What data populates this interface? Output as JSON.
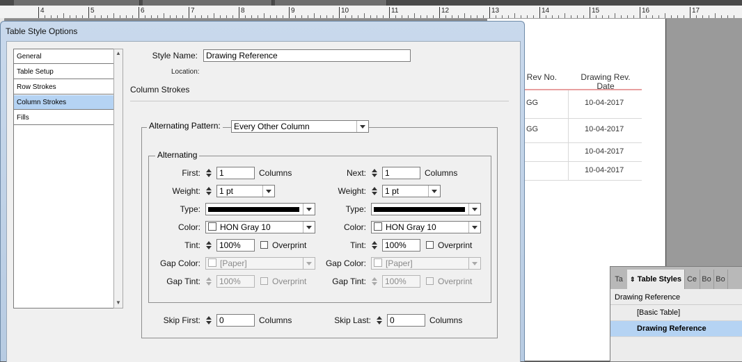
{
  "dialog": {
    "title": "Table Style Options",
    "categories": [
      "General",
      "Table Setup",
      "Row Strokes",
      "Column Strokes",
      "Fills"
    ],
    "selected_category": "Column Strokes",
    "style_name_label": "Style Name:",
    "style_name_value": "Drawing Reference",
    "location_label": "Location:",
    "section_title": "Column Strokes",
    "alternating_pattern_label": "Alternating Pattern:",
    "alternating_pattern_value": "Every Other Column",
    "alternating_group_label": "Alternating",
    "first": {
      "label": "First:",
      "value": "1",
      "unit": "Columns",
      "weight_label": "Weight:",
      "weight": "1 pt",
      "type_label": "Type:",
      "color_label": "Color:",
      "color": "HON Gray 10",
      "tint_label": "Tint:",
      "tint": "100%",
      "overprint": "Overprint",
      "gap_color_label": "Gap Color:",
      "gap_color": "[Paper]",
      "gap_tint_label": "Gap Tint:",
      "gap_tint": "100%",
      "gap_overprint": "Overprint"
    },
    "next": {
      "label": "Next:",
      "value": "1",
      "unit": "Columns",
      "weight_label": "Weight:",
      "weight": "1 pt",
      "type_label": "Type:",
      "color_label": "Color:",
      "color": "HON Gray 10",
      "tint_label": "Tint:",
      "tint": "100%",
      "overprint": "Overprint",
      "gap_color_label": "Gap Color:",
      "gap_color": "[Paper]",
      "gap_tint_label": "Gap Tint:",
      "gap_tint": "100%",
      "gap_overprint": "Overprint"
    },
    "skip_first_label": "Skip First:",
    "skip_first_value": "0",
    "skip_first_unit": "Columns",
    "skip_last_label": "Skip Last:",
    "skip_last_value": "0",
    "skip_last_unit": "Columns"
  },
  "ruler": {
    "numbers": [
      "4",
      "5",
      "6",
      "7",
      "8",
      "9",
      "10",
      "11",
      "12",
      "13",
      "14",
      "15",
      "16",
      "17"
    ]
  },
  "page_table": {
    "headers": [
      "ng Rev No.",
      "Drawing Rev.\nDate"
    ],
    "col1": [
      "GG",
      "GG",
      "",
      ""
    ],
    "col2": [
      "10-04-2017",
      "10-04-2017",
      "10-04-2017",
      "10-04-2017"
    ]
  },
  "table_styles_panel": {
    "tabs": [
      "Ta",
      "Table Styles",
      "Ce",
      "Bo",
      "Bo"
    ],
    "current": "Drawing Reference",
    "items": [
      "[Basic Table]",
      "Drawing Reference"
    ],
    "selected": "Drawing Reference"
  }
}
